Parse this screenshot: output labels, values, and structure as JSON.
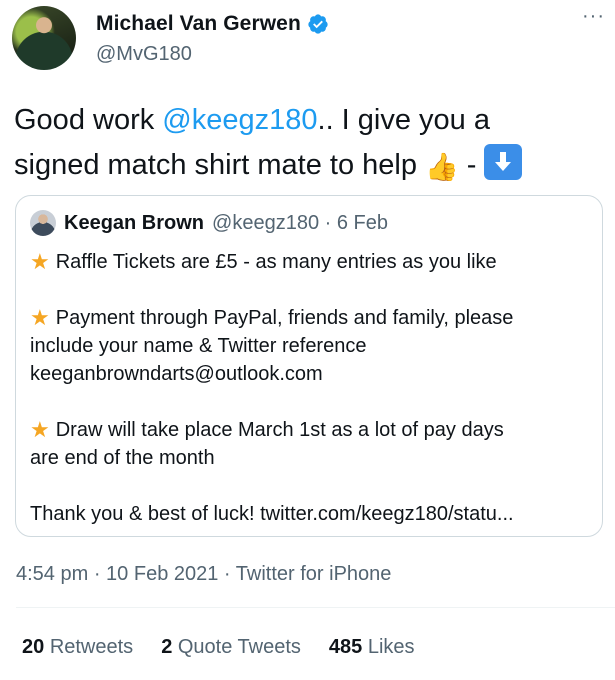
{
  "author": {
    "name": "Michael Van Gerwen",
    "handle": "@MvG180",
    "verified": true,
    "more_icon": "more-horizontal-icon"
  },
  "tweet": {
    "text_part1": "Good work ",
    "mention": "@keegz180",
    "text_part2": ".. I give you a",
    "line2_text": "signed match shirt mate to help ",
    "thumbs_emoji": "👍",
    "dash": " - ",
    "down_arrow_icon": "down-arrow-emoji-icon"
  },
  "quote": {
    "name": "Keegan Brown",
    "handle": "@keegz180",
    "separator": " · ",
    "date": "6 Feb",
    "star_icon": "star-emoji-icon",
    "paragraph1": "Raffle Tickets are £5 - as many entries as you like",
    "paragraph2_line1": "Payment through PayPal, friends and family, please",
    "paragraph2_line2": "include your name & Twitter reference",
    "paragraph2_line3": "keeganbrowndarts@outlook.com",
    "paragraph3_line1": "Draw will take place March 1st as a lot of pay days",
    "paragraph3_line2": "are end of the month",
    "paragraph4": "Thank you & best of luck! twitter.com/keegz180/statu..."
  },
  "meta": {
    "time": "4:54 pm",
    "separator": " · ",
    "date": "10 Feb 2021",
    "source": "Twitter for iPhone"
  },
  "stats": {
    "retweets_count": "20",
    "retweets_label": "Retweets",
    "quotes_count": "2",
    "quotes_label": "Quote Tweets",
    "likes_count": "485",
    "likes_label": "Likes"
  },
  "colors": {
    "link": "#1d9bf0",
    "secondary_text": "#536471",
    "primary_text": "#0f1419",
    "border": "#cfd9de"
  }
}
